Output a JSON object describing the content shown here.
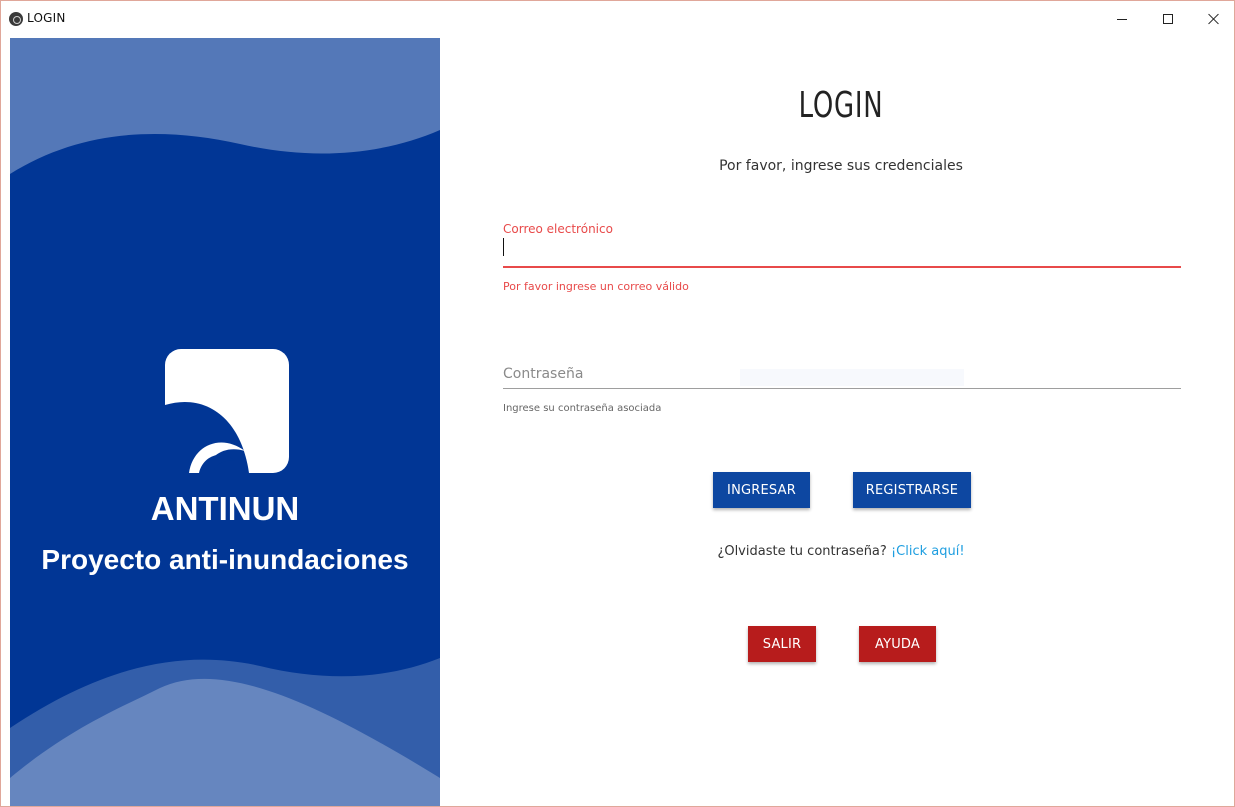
{
  "window": {
    "title": "LOGIN",
    "controls": {
      "minimize_icon": "minimize-icon",
      "maximize_icon": "maximize-icon",
      "close_icon": "close-icon"
    }
  },
  "brand": {
    "name": "ANTINUN",
    "subtitle": "Proyecto anti-inundaciones",
    "panel_color": "#013695"
  },
  "form": {
    "title": "LOGIN",
    "subtitle": "Por favor, ingrese sus credenciales",
    "email": {
      "label": "Correo electrónico",
      "value": "",
      "error": "Por favor ingrese un correo válido",
      "error_color": "#e84a4a"
    },
    "password": {
      "placeholder": "Contraseña",
      "value": "",
      "hint": "Ingrese su contraseña asociada"
    },
    "buttons": {
      "login": "INGRESAR",
      "register": "REGISTRARSE",
      "exit": "SALIR",
      "help": "AYUDA"
    },
    "forgot": {
      "text": "¿Olvidaste tu contraseña?",
      "link": "¡Click aquí!"
    }
  },
  "colors": {
    "primary_blue": "#0d47a1",
    "danger_red": "#b71c1c",
    "link_blue": "#1e9ee0"
  }
}
